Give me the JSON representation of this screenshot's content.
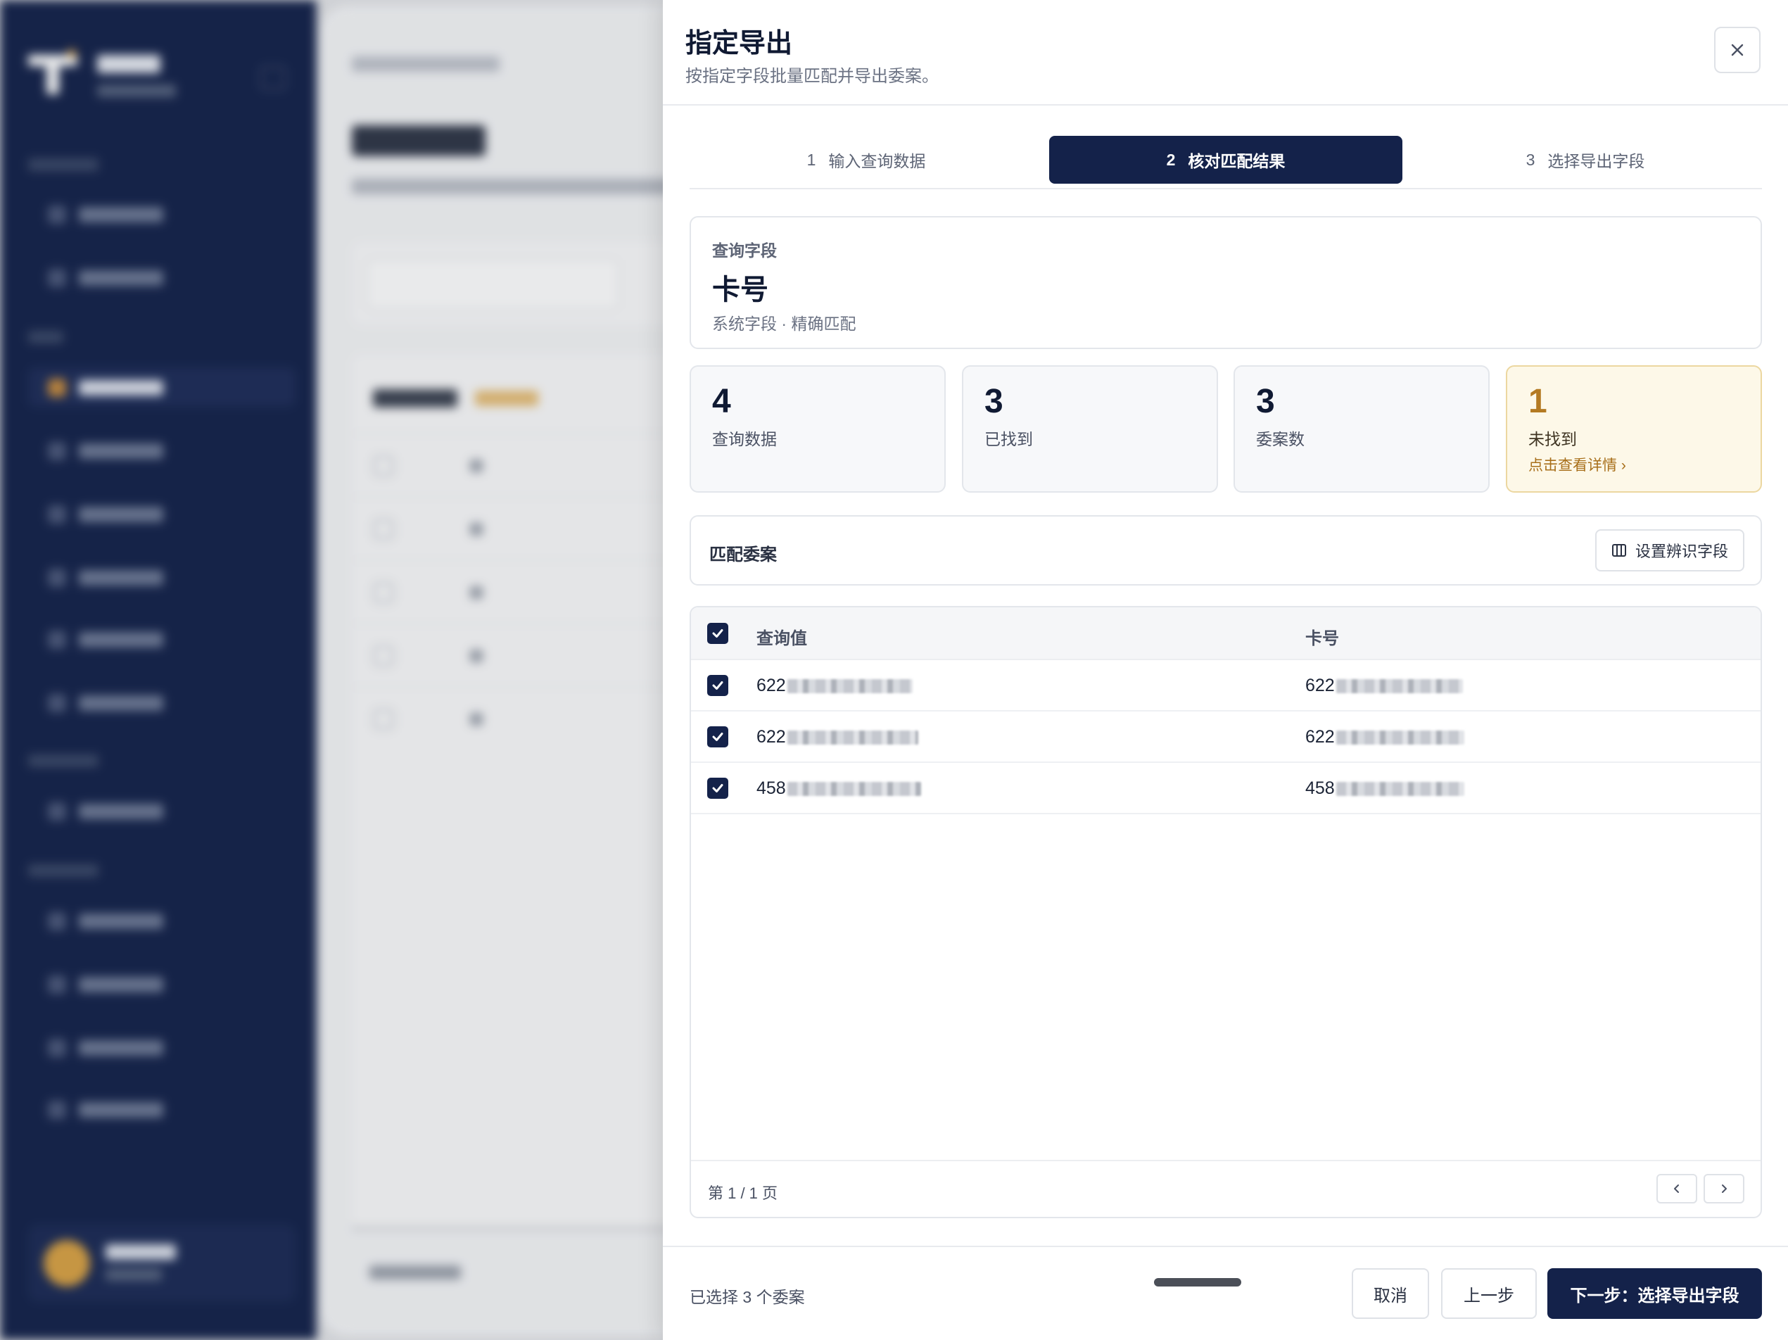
{
  "drawer": {
    "title": "指定导出",
    "subtitle": "按指定字段批量匹配并导出委案。",
    "close_icon": "close-icon"
  },
  "steps": [
    {
      "num": "1",
      "label": "输入查询数据",
      "active": false
    },
    {
      "num": "2",
      "label": "核对匹配结果",
      "active": true
    },
    {
      "num": "3",
      "label": "选择导出字段",
      "active": false
    }
  ],
  "query_field": {
    "label": "查询字段",
    "value": "卡号",
    "desc": "系统字段 · 精确匹配"
  },
  "stats": [
    {
      "value": "4",
      "label": "查询数据"
    },
    {
      "value": "3",
      "label": "已找到"
    },
    {
      "value": "3",
      "label": "委案数"
    },
    {
      "value": "1",
      "label": "未找到",
      "link": "点击查看详情 ›"
    }
  ],
  "matched": {
    "title": "匹配委案",
    "button_label": "设置辨识字段",
    "button_icon": "columns-icon"
  },
  "table": {
    "headers": [
      "查询值",
      "卡号"
    ],
    "rows": [
      {
        "query_value": "622",
        "card_no": "622"
      },
      {
        "query_value": "622",
        "card_no": "622"
      },
      {
        "query_value": "458",
        "card_no": "458"
      }
    ],
    "page_text": "第 1 / 1 页"
  },
  "footer": {
    "selected_text": "已选择 3 个委案",
    "cancel": "取消",
    "prev": "上一步",
    "next": "下一步：选择导出字段"
  },
  "colors": {
    "primary": "#14224a",
    "warning_bg": "#fdf8e8",
    "warning_text": "#b47a22"
  }
}
